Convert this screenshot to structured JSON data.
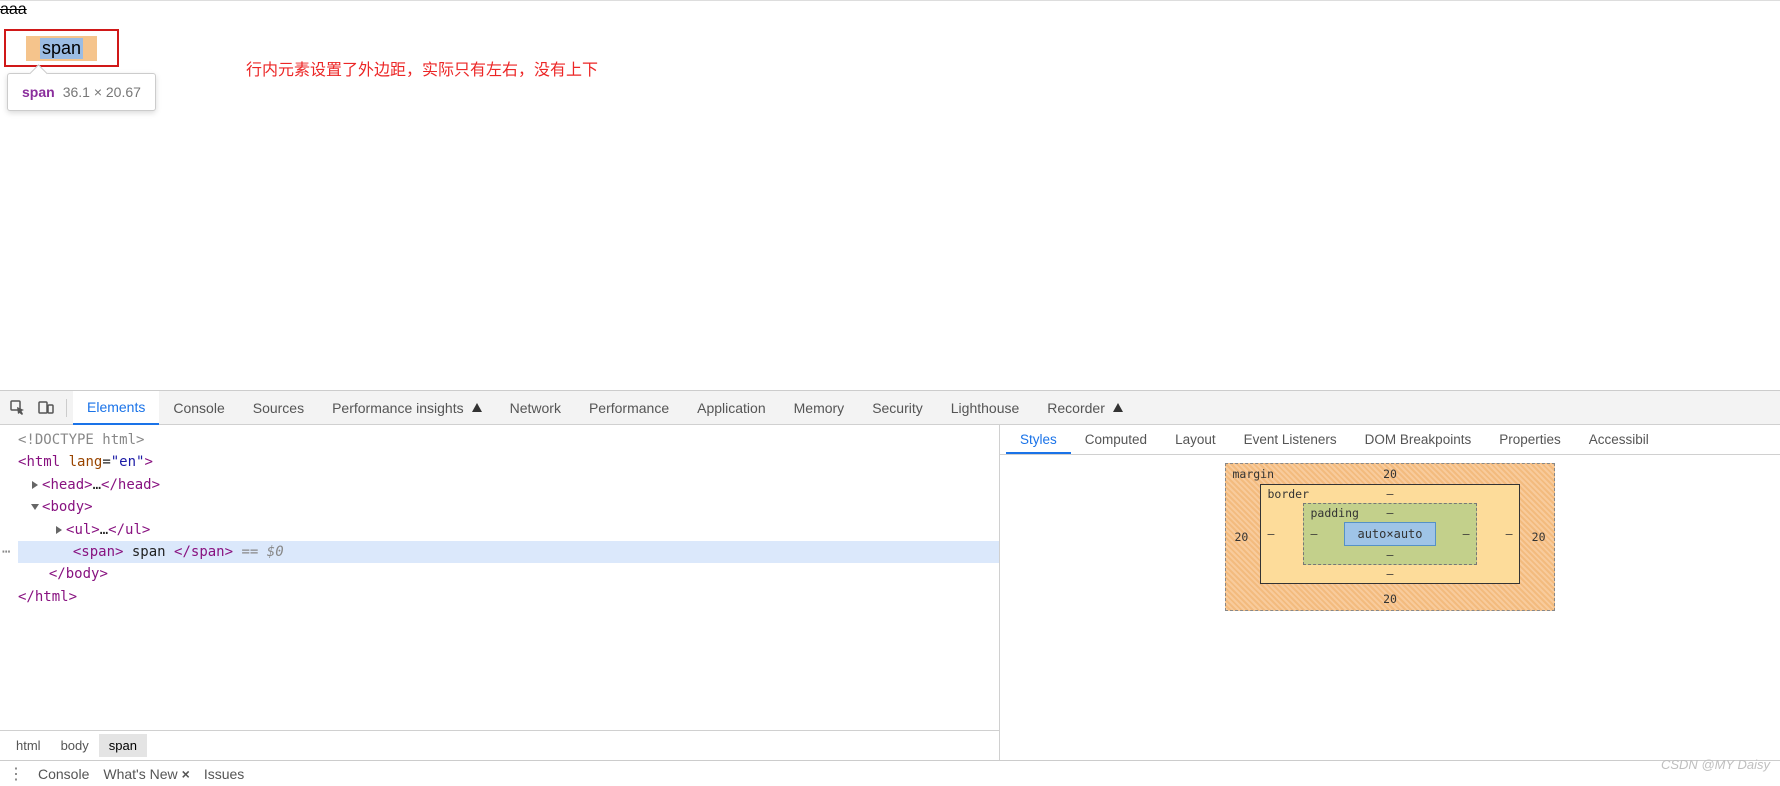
{
  "page": {
    "aaa": "aaa",
    "span_text": "span",
    "annotation": "行内元素设置了外边距，实际只有左右，没有上下"
  },
  "tooltip": {
    "tag": "span",
    "dims": "36.1 × 20.67"
  },
  "devtools_tabs": [
    "Elements",
    "Console",
    "Sources",
    "Performance insights",
    "Network",
    "Performance",
    "Application",
    "Memory",
    "Security",
    "Lighthouse",
    "Recorder"
  ],
  "dom": {
    "l1": "<!DOCTYPE html>",
    "l2a": "<",
    "l2b": "html",
    "l2c": " lang",
    "l2d": "=",
    "l2e": "\"en\"",
    "l2f": ">",
    "l3a": "<",
    "l3b": "head",
    "l3c": ">",
    "l3d": "…",
    "l3e": "</",
    "l3f": "head",
    "l3g": ">",
    "l4a": "<",
    "l4b": "body",
    "l4c": ">",
    "l5a": "<",
    "l5b": "ul",
    "l5c": ">",
    "l5d": "…",
    "l5e": "</",
    "l5f": "ul",
    "l5g": ">",
    "l6a": "<",
    "l6b": "span",
    "l6c": ">",
    "l6d": " span ",
    "l6e": "</",
    "l6f": "span",
    "l6g": ">",
    "l6h": " == $0",
    "l7a": "</",
    "l7b": "body",
    "l7c": ">",
    "l8a": "</",
    "l8b": "html",
    "l8c": ">"
  },
  "crumbs": [
    "html",
    "body",
    "span"
  ],
  "styles_tabs": [
    "Styles",
    "Computed",
    "Layout",
    "Event Listeners",
    "DOM Breakpoints",
    "Properties",
    "Accessibil"
  ],
  "boxmodel": {
    "margin_name": "margin",
    "border_name": "border",
    "padding_name": "padding",
    "margin": {
      "top": "20",
      "right": "20",
      "bottom": "20",
      "left": "20"
    },
    "border": {
      "top": "‒",
      "right": "‒",
      "bottom": "‒",
      "left": "‒"
    },
    "padding": {
      "top": "‒",
      "right": "‒",
      "bottom": "‒",
      "left": "‒"
    },
    "content": "auto×auto"
  },
  "drawer": {
    "console": "Console",
    "whatsnew": "What's New",
    "issues": "Issues"
  },
  "watermark": "CSDN @MY Daisy"
}
